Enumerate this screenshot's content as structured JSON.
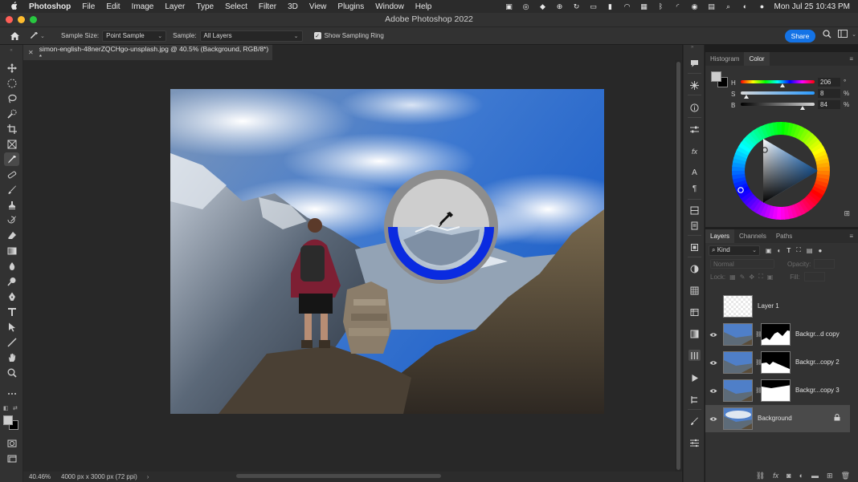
{
  "menubar": {
    "app_name": "Photoshop",
    "items": [
      "File",
      "Edit",
      "Image",
      "Layer",
      "Type",
      "Select",
      "Filter",
      "3D",
      "View",
      "Plugins",
      "Window",
      "Help"
    ],
    "clock": "Mon Jul 25  10:43 PM"
  },
  "window": {
    "title": "Adobe Photoshop 2022"
  },
  "options": {
    "sample_size_label": "Sample Size:",
    "sample_size_value": "Point Sample",
    "sample_label": "Sample:",
    "sample_value": "All Layers",
    "show_ring_label": "Show Sampling Ring",
    "share_label": "Share"
  },
  "document": {
    "tab_title": "simon-english-48nerZQCHgo-unsplash.jpg @ 40.5% (Background, RGB/8*) *",
    "zoom": "40.46%",
    "info": "4000 px x 3000 px (72 ppi)"
  },
  "color_panel": {
    "tabs": [
      "Histogram",
      "Color"
    ],
    "active_tab": "Color",
    "foreground": "#cecece",
    "background": "#000000",
    "h": {
      "label": "H",
      "value": "206",
      "unit": "°",
      "fraction": 0.57
    },
    "s": {
      "label": "S",
      "value": "8",
      "unit": "%",
      "fraction": 0.08
    },
    "b": {
      "label": "B",
      "value": "84",
      "unit": "%",
      "fraction": 0.84
    }
  },
  "layers_panel": {
    "tabs": [
      "Layers",
      "Channels",
      "Paths"
    ],
    "active_tab": "Layers",
    "filter_label": "Kind",
    "blend_mode": "Normal",
    "opacity_label": "Opacity:",
    "lock_label": "Lock:",
    "fill_label": "Fill:",
    "layers": [
      {
        "name": "Layer 1"
      },
      {
        "name": "Backgr...d copy"
      },
      {
        "name": "Backgr...copy 2"
      },
      {
        "name": "Backgr...copy 3"
      },
      {
        "name": "Background"
      }
    ]
  },
  "colors": {
    "accent": "#1473e6",
    "sampling_ring_lower": "#0a2be0",
    "sampling_ring_upper": "#cecece"
  }
}
